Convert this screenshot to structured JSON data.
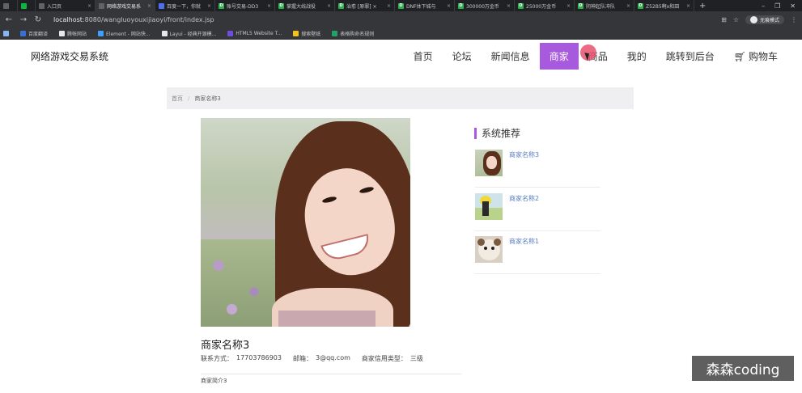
{
  "browser": {
    "tabs": [
      {
        "title": "",
        "icon": "chrome-icon",
        "color": "#5f6368"
      },
      {
        "title": "",
        "icon": "wechat-icon",
        "color": "#09b83e"
      },
      {
        "title": "入口页",
        "icon": "page-icon",
        "color": "#5f6368"
      },
      {
        "title": "网络游戏交易系",
        "icon": "page-icon",
        "color": "#5f6368"
      },
      {
        "title": "百度一下，你就",
        "icon": "baidu-icon",
        "color": "#4e6ef2"
      },
      {
        "title": "账号交易-DD3",
        "icon": "d-icon",
        "color": "#2bb24c"
      },
      {
        "title": "掌握大线战役",
        "icon": "d-icon",
        "color": "#2bb24c"
      },
      {
        "title": "治愈 [原罪] ×",
        "icon": "d-icon",
        "color": "#2bb24c"
      },
      {
        "title": "DNF体下城与",
        "icon": "d-icon",
        "color": "#2bb24c"
      },
      {
        "title": "300000万金币",
        "icon": "d-icon",
        "color": "#2bb24c"
      },
      {
        "title": "25000万金币",
        "icon": "d-icon",
        "color": "#2bb24c"
      },
      {
        "title": "阴神起队冲队",
        "icon": "d-icon",
        "color": "#2bb24c"
      },
      {
        "title": "Z52B5啊x和田",
        "icon": "d-icon",
        "color": "#2bb24c"
      }
    ],
    "url_host": "localhost",
    "url_path": ":8080/wangluoyouxijiaoyi/front/index.jsp",
    "profile_label": "无痕模式",
    "bookmarks": [
      {
        "label": "百度翻译",
        "color": "#3b6fd8"
      },
      {
        "label": "腾帐网站",
        "color": "#e8e8e8"
      },
      {
        "label": "Element - 网站快...",
        "color": "#409eff"
      },
      {
        "label": "Layui - 经典开源模...",
        "color": "#e8e8e8"
      },
      {
        "label": "HTML5 Website T...",
        "color": "#6c4de0"
      },
      {
        "label": "搜索壁纸",
        "color": "#f2c318"
      },
      {
        "label": "表格购命名规则",
        "color": "#21a366"
      }
    ]
  },
  "site": {
    "title": "网络游戏交易系统",
    "menu": [
      {
        "label": "首页",
        "active": false
      },
      {
        "label": "论坛",
        "active": false
      },
      {
        "label": "新闻信息",
        "active": false
      },
      {
        "label": "商家",
        "active": true
      },
      {
        "label": "商品",
        "active": false
      },
      {
        "label": "我的",
        "active": false
      },
      {
        "label": "跳转到后台",
        "active": false
      }
    ],
    "cart_label": "购物车",
    "accent": "#a85adf"
  },
  "breadcrumb": {
    "home": "首页",
    "separator": "/",
    "current": "商家名称3"
  },
  "detail": {
    "name": "商家名称3",
    "contact_label": "联系方式：",
    "contact": "17703786903",
    "email_label": "邮箱：",
    "email": "3@qq.com",
    "credit_label": "商家信用类型：",
    "credit": "三级",
    "intro": "商家简介3"
  },
  "recommend": {
    "title": "系统推荐",
    "items": [
      {
        "name": "商家名称3"
      },
      {
        "name": "商家名称2"
      },
      {
        "name": "商家名称1"
      }
    ]
  },
  "watermark": "森森coding"
}
